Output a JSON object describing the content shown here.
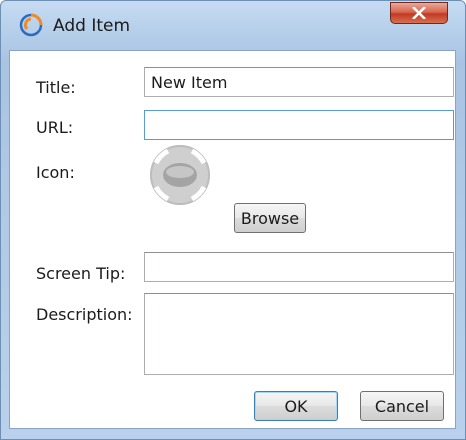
{
  "window": {
    "title": "Add Item",
    "app_icon": "swirl-app-icon",
    "close_icon": "close-x-icon"
  },
  "form": {
    "title_label": "Title:",
    "title_value": "New Item",
    "url_label": "URL:",
    "url_value": "",
    "icon_label": "Icon:",
    "icon_preview": "round-button-icon",
    "browse_label": "Browse",
    "screen_tip_label": "Screen Tip:",
    "screen_tip_value": "",
    "description_label": "Description:",
    "description_value": ""
  },
  "buttons": {
    "ok_label": "OK",
    "cancel_label": "Cancel"
  },
  "colors": {
    "frame": "#b6cfea",
    "close_button": "#c9452c",
    "focus_border": "#5b9bd5"
  }
}
